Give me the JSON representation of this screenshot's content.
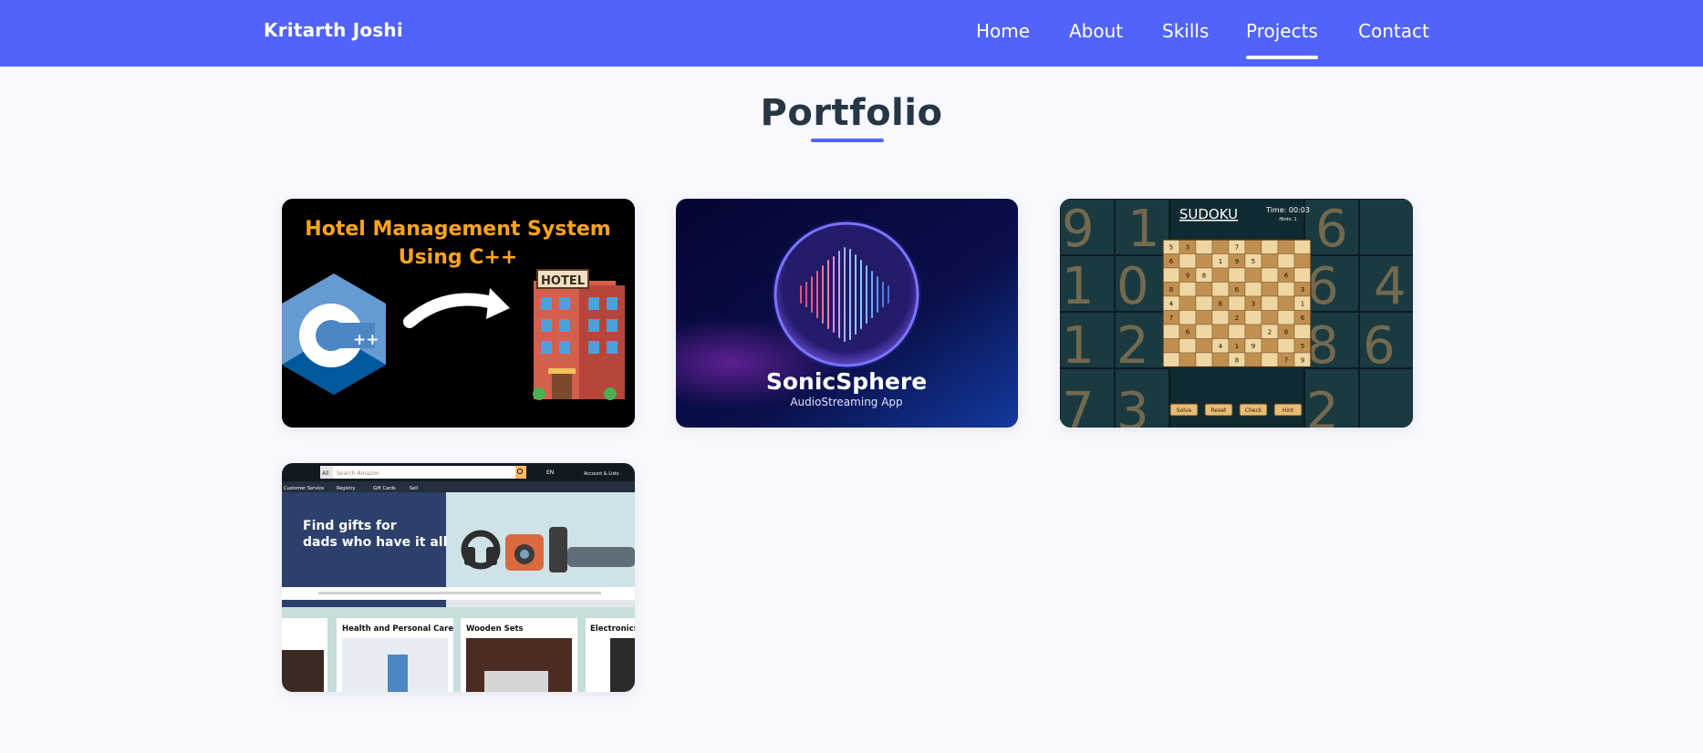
{
  "brand": "Kritarth Joshi",
  "nav": [
    {
      "label": "Home",
      "active": false
    },
    {
      "label": "About",
      "active": false
    },
    {
      "label": "Skills",
      "active": false
    },
    {
      "label": "Projects",
      "active": true
    },
    {
      "label": "Contact",
      "active": false
    }
  ],
  "portfolio": {
    "title": "Portfolio",
    "cards": [
      {
        "title_line1": "Hotel Management System",
        "title_line2": "Using C++",
        "logo_text": "++",
        "sign_text": "HOTEL"
      },
      {
        "title": "SonicSphere",
        "subtitle": "AudioStreaming App"
      },
      {
        "title": "SUDOKU",
        "timer": "Time: 00:03",
        "hints": "Hints: 1",
        "buttons": [
          "Solve",
          "Reset",
          "Check",
          "Hint"
        ],
        "cells": [
          "5",
          "3",
          "",
          "",
          "7",
          "",
          "",
          "",
          "",
          "6",
          "",
          "",
          "1",
          "9",
          "5",
          "",
          "",
          "",
          "",
          "9",
          "8",
          "",
          "",
          "",
          "",
          "6",
          "",
          "8",
          "",
          "",
          "",
          "6",
          "",
          "",
          "",
          "3",
          "4",
          "",
          "",
          "8",
          "",
          "3",
          "",
          "",
          "1",
          "7",
          "",
          "",
          "",
          "2",
          "",
          "",
          "",
          "6",
          "",
          "6",
          "",
          "",
          "",
          "",
          "2",
          "8",
          "",
          "",
          "",
          "",
          "4",
          "1",
          "9",
          "",
          "",
          "5",
          "",
          "",
          "",
          "",
          "8",
          "",
          "",
          "7",
          "9"
        ]
      },
      {
        "search_placeholder": "Search Amazon",
        "search_scope": "All",
        "account_label": "Account & Lists",
        "lang": "EN",
        "nav_items": [
          "Customer Service",
          "Registry",
          "Gift Cards",
          "Sell"
        ],
        "hero_line1": "Find gifts for",
        "hero_line2": "dads who have it all",
        "categories": [
          "Health and Personal Care",
          "Wooden Sets",
          "Electronics"
        ]
      }
    ]
  }
}
